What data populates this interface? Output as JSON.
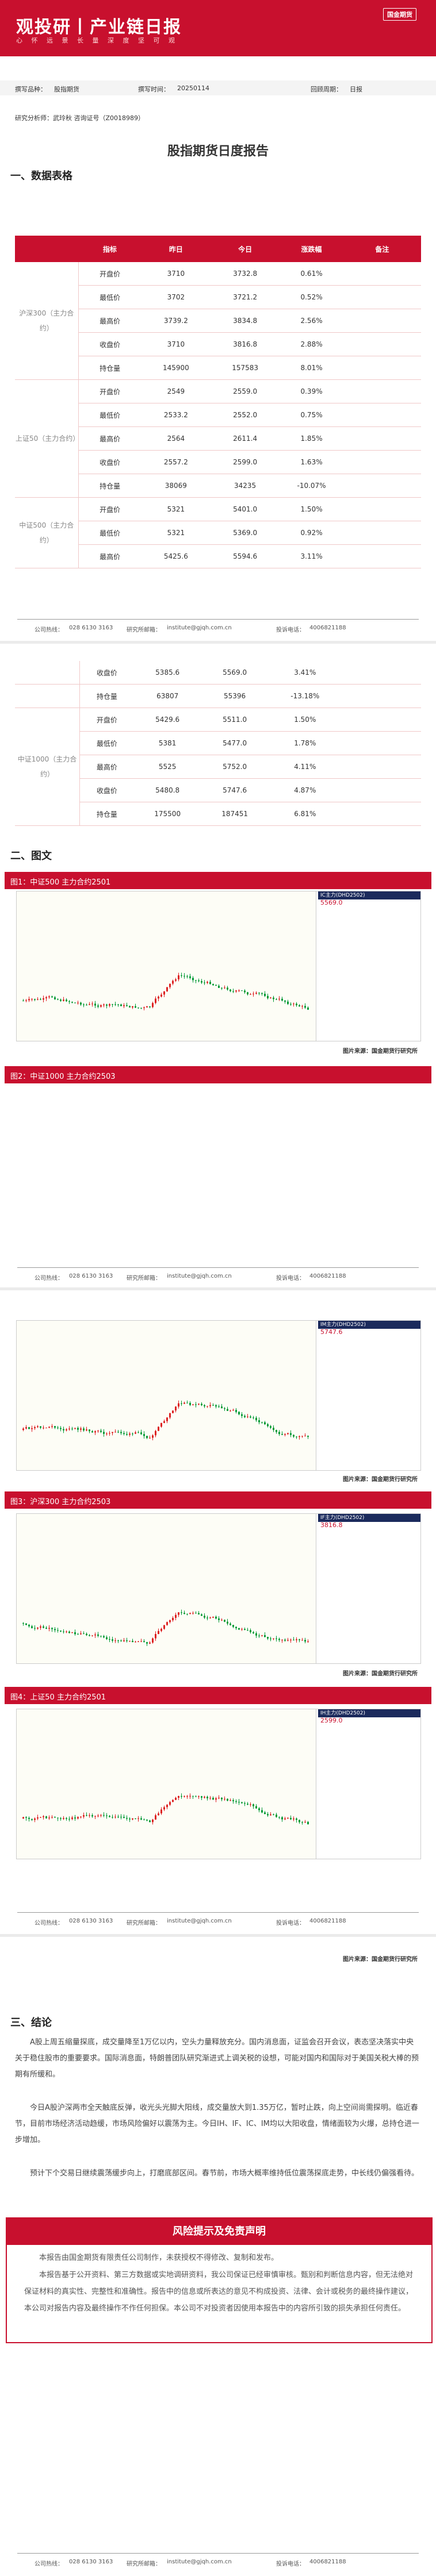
{
  "brand": {
    "name": "观投研丨产业链日报",
    "sub": "心 怀 远 景   长 量 深 度   坚 可 观",
    "logo": "国金期货"
  },
  "meta": {
    "type_label": "撰写品种：",
    "type_value": "股指期货",
    "time_label": "撰写时间：",
    "time_value": "20250114",
    "period_label": "回顾周期：",
    "period_value": "日报",
    "analyst": "研究分析师：武玲秋  咨询证号（Z0018989）"
  },
  "title": "股指期货日度报告",
  "sections": {
    "s1": "一、数据表格",
    "s2": "二、图文",
    "s3": "三、结论"
  },
  "table": {
    "headers": [
      "指标",
      "昨日",
      "今日",
      "涨跌幅",
      "备注"
    ],
    "groups": [
      {
        "label": "沪深300（主力合约）",
        "rows": [
          [
            "开盘价",
            "3710",
            "3732.8",
            "0.61%"
          ],
          [
            "最低价",
            "3702",
            "3721.2",
            "0.52%"
          ],
          [
            "最高价",
            "3739.2",
            "3834.8",
            "2.56%"
          ],
          [
            "收盘价",
            "3710",
            "3816.8",
            "2.88%"
          ],
          [
            "持仓量",
            "145900",
            "157583",
            "8.01%"
          ]
        ]
      },
      {
        "label": "上证50（主力合约）",
        "rows": [
          [
            "开盘价",
            "2549",
            "2559.0",
            "0.39%"
          ],
          [
            "最低价",
            "2533.2",
            "2552.0",
            "0.75%"
          ],
          [
            "最高价",
            "2564",
            "2611.4",
            "1.85%"
          ],
          [
            "收盘价",
            "2557.2",
            "2599.0",
            "1.63%"
          ],
          [
            "持仓量",
            "38069",
            "34235",
            "-10.07%"
          ]
        ]
      },
      {
        "label": "中证500（主力合约）",
        "rows": [
          [
            "开盘价",
            "5321",
            "5401.0",
            "1.50%"
          ],
          [
            "最低价",
            "5321",
            "5369.0",
            "0.92%"
          ],
          [
            "最高价",
            "5425.6",
            "5594.6",
            "3.11%"
          ]
        ]
      }
    ],
    "cont_rows": [
      [
        "收盘价",
        "5385.6",
        "5569.0",
        "3.41%"
      ],
      [
        "持仓量",
        "63807",
        "55396",
        "-13.18%"
      ]
    ],
    "group1000": {
      "label": "中证1000（主力合约）",
      "rows": [
        [
          "开盘价",
          "5429.6",
          "5511.0",
          "1.50%"
        ],
        [
          "最低价",
          "5381",
          "5477.0",
          "1.78%"
        ],
        [
          "最高价",
          "5525",
          "5752.0",
          "4.11%"
        ],
        [
          "收盘价",
          "5480.8",
          "5747.6",
          "4.87%"
        ],
        [
          "持仓量",
          "175500",
          "187451",
          "6.81%"
        ]
      ]
    }
  },
  "footer": {
    "phone_label": "公司热线：",
    "phone": "028 6130 3163",
    "email_label": "研究所邮箱：",
    "email": "institute@gjqh.com.cn",
    "complaint_label": "投诉电话：",
    "complaint": "4006821188"
  },
  "figures": [
    {
      "caption": "图1：中证500 主力合约2501",
      "code": "IC主力(DHD2502)",
      "price": "5569.0"
    },
    {
      "caption": "图2：中证1000 主力合约2503",
      "code": "IM主力(DHD2502)",
      "price": "5747.6"
    },
    {
      "caption": "图3：沪深300 主力合约2503",
      "code": "IF主力(DHD2502)",
      "price": "3816.8"
    },
    {
      "caption": "图4：上证50 主力合约2501",
      "code": "IH主力(DHD2502)",
      "price": "2599.0"
    }
  ],
  "source": "图片来源：国金期货行研究所",
  "conclusion": [
    "A股上周五缩量探底，成交量降至1万亿以内，空头力量释放充分。国内消息面，证监会召开会议，表态坚决落实中央关于稳住股市的重要要求。国际消息面，特朗普团队研究渐进式上调关税的设想，可能对国内和国际对于美国关税大棒的预期有所缓和。",
    "今日A股沪深两市全天触底反弹，收光头光脚大阳线，成交量放大到1.35万亿，暂时止跌，向上空间尚需探明。临近春节，目前市场经济活动趋缓，市场风险偏好以震荡为主。今日IH、IF、IC、IM均以大阳收盘，情绪面较为火爆，总持仓进一步增加。",
    "预计下个交易日继续震荡缓步向上，打磨底部区间。春节前，市场大概率维持低位震荡探底走势，中长线仍偏强看待。"
  ],
  "risk": {
    "title": "风险提示及免责声明",
    "paras": [
      "本报告由国金期货有限责任公司制作，未获授权不得修改、复制和发布。",
      "本报告基于公开资料、第三方数据或实地调研资料，我公司保证已经审慎审核。甄别和判断信息内容，但无法绝对保证材料的真实性、完整性和准确性。报告中的信息或所表达的意见不构成投资、法律、会计或税务的最终操作建议，本公司对报告内容及最终操作不作任何担保。本公司不对投资者因使用本报告中的内容所引致的损失承担任何责任。"
    ]
  }
}
